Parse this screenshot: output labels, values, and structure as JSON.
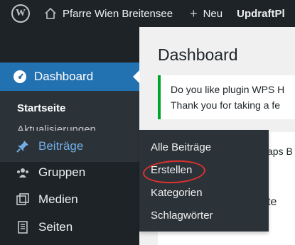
{
  "adminbar": {
    "logo_letter": "W",
    "site_name": "Pfarre Wien Breitensee",
    "new_label": "Neu",
    "plugin_label": "UpdraftPl"
  },
  "sidebar": {
    "dashboard_label": "Dashboard",
    "submenu": [
      "Startseite",
      "Aktualisierungen"
    ],
    "items": [
      "Beiträge",
      "Gruppen",
      "Medien",
      "Seiten"
    ]
  },
  "flyout": {
    "items": [
      "Alle Beiträge",
      "Erstellen",
      "Kategorien",
      "Schlagwörter"
    ],
    "highlight_color": "#e03030"
  },
  "main": {
    "title": "Dashboard",
    "notice_line1": "Do you like plugin WPS H",
    "notice_line2": "Thank you for taking a fe",
    "fragment1": "aps B",
    "fragment2": "te"
  },
  "colors": {
    "adminbar_bg": "#1d2327",
    "active_blue": "#2271b1",
    "notice_green": "#00a32a"
  }
}
